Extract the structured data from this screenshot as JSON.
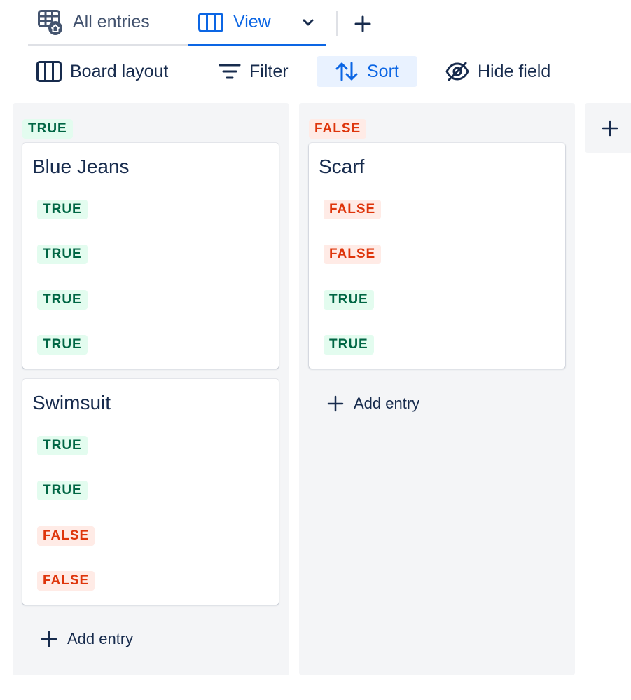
{
  "tabs": {
    "all_entries": "All entries",
    "view": "View"
  },
  "toolbar": {
    "board_layout": "Board layout",
    "filter": "Filter",
    "sort": "Sort",
    "hide_field": "Hide field"
  },
  "columns": [
    {
      "label": "TRUE",
      "cards": [
        {
          "title": "Blue Jeans",
          "fields": [
            "TRUE",
            "TRUE",
            "TRUE",
            "TRUE"
          ]
        },
        {
          "title": "Swimsuit",
          "fields": [
            "TRUE",
            "TRUE",
            "FALSE",
            "FALSE"
          ]
        }
      ],
      "add_entry": "Add entry"
    },
    {
      "label": "FALSE",
      "cards": [
        {
          "title": "Scarf",
          "fields": [
            "FALSE",
            "FALSE",
            "TRUE",
            "TRUE"
          ]
        }
      ],
      "add_entry": "Add entry"
    }
  ],
  "colors": {
    "accent": "#0c66e4",
    "true_text": "#006644",
    "true_bg": "#e3fcef",
    "false_text": "#de350b",
    "false_bg": "#ffebe6"
  },
  "icons": {
    "all_entries": "table-home-icon",
    "view": "board-columns-icon",
    "view_menu": "chevron-down-icon",
    "add_view": "plus-icon",
    "board_layout": "board-columns-icon",
    "filter": "filter-icon",
    "sort": "sort-arrows-icon",
    "hide_field": "eye-slash-icon"
  }
}
